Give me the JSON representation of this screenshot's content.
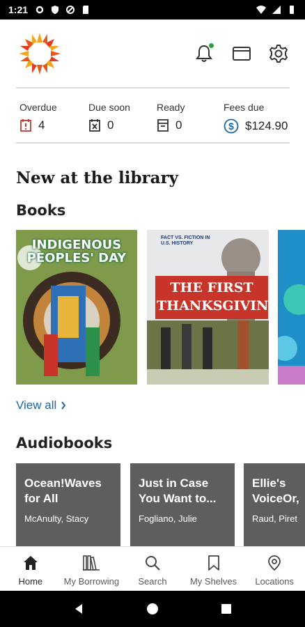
{
  "status_bar": {
    "time": "1:21"
  },
  "header": {
    "logo_icon": "library-sunburst-logo",
    "notifications_icon": "bell-icon",
    "card_icon": "library-card-icon",
    "settings_icon": "gear-icon",
    "notification_dot_color": "#2e9e3f"
  },
  "summary": {
    "overdue": {
      "label": "Overdue",
      "value": "4",
      "icon": "calendar-alert-icon",
      "color": "#c0392b"
    },
    "due_soon": {
      "label": "Due soon",
      "value": "0",
      "icon": "calendar-x-icon"
    },
    "ready": {
      "label": "Ready",
      "value": "0",
      "icon": "ready-shelf-icon"
    },
    "fees_due": {
      "label": "Fees due",
      "value": "$124.90",
      "icon": "dollar-circle-icon",
      "color": "#1768a5"
    }
  },
  "main": {
    "section_title": "New at the library",
    "books_title": "Books",
    "books": [
      {
        "cover_text": "INDIGENOUS PEOPLES' DAY"
      },
      {
        "series_text": "FACT VS. FICTION IN U.S. HISTORY",
        "cover_text": "THE FIRST THANKSGIVING"
      },
      {
        "cover_text": ""
      }
    ],
    "view_all": "View all",
    "audiobooks_title": "Audiobooks",
    "audiobooks": [
      {
        "title": "Ocean!Waves\nfor All",
        "author": "McAnulty, Stacy"
      },
      {
        "title": "Just in Case\nYou Want to...",
        "author": "Fogliano, Julie"
      },
      {
        "title": "Ellie's\nVoiceOr,",
        "author": "Raud, Piret"
      }
    ]
  },
  "bottom_nav": [
    {
      "label": "Home",
      "icon": "home-icon",
      "active": true
    },
    {
      "label": "My Borrowing",
      "icon": "books-icon",
      "active": false
    },
    {
      "label": "Search",
      "icon": "search-icon",
      "active": false
    },
    {
      "label": "My Shelves",
      "icon": "bookmark-icon",
      "active": false
    },
    {
      "label": "Locations",
      "icon": "location-pin-icon",
      "active": false
    }
  ],
  "colors": {
    "accent": "#1768a5",
    "tile": "#5e5e5e"
  }
}
